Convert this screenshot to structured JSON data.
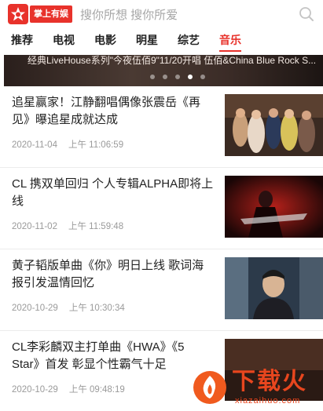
{
  "header": {
    "logo_text": "掌上有娱",
    "search_placeholder": "搜你所想 搜你所爱"
  },
  "tabs": [
    {
      "label": "推荐",
      "active": false
    },
    {
      "label": "电视",
      "active": false
    },
    {
      "label": "电影",
      "active": false
    },
    {
      "label": "明星",
      "active": false
    },
    {
      "label": "综艺",
      "active": false
    },
    {
      "label": "音乐",
      "active": true
    }
  ],
  "banner": {
    "caption": "经典LiveHouse系列\"今夜伍佰9\"11/20开唱  伍佰&China Blue Rock S...",
    "dot_count": 5,
    "active_dot": 3
  },
  "news": [
    {
      "title": "追星赢家！江静翻唱偶像张震岳《再见》曝追星成就达成",
      "date": "2020-11-04",
      "time": "上午 11:06:59"
    },
    {
      "title": "CL 携双单回归 个人专辑ALPHA即将上线",
      "date": "2020-11-02",
      "time": "上午 11:59:48"
    },
    {
      "title": "黄子韬版单曲《你》明日上线 歌词海报引发温情回忆",
      "date": "2020-10-29",
      "time": "上午 10:30:34"
    },
    {
      "title": "CL李彩麟双主打单曲《HWA》《5 Star》首发 彰显个性霸气十足",
      "date": "2020-10-29",
      "time": "上午 09:48:19"
    }
  ],
  "watermark": {
    "title": "下载火",
    "url": "xiazaihuo.com"
  },
  "colors": {
    "accent": "#e8322b",
    "meta_text": "#9a9a9a"
  }
}
